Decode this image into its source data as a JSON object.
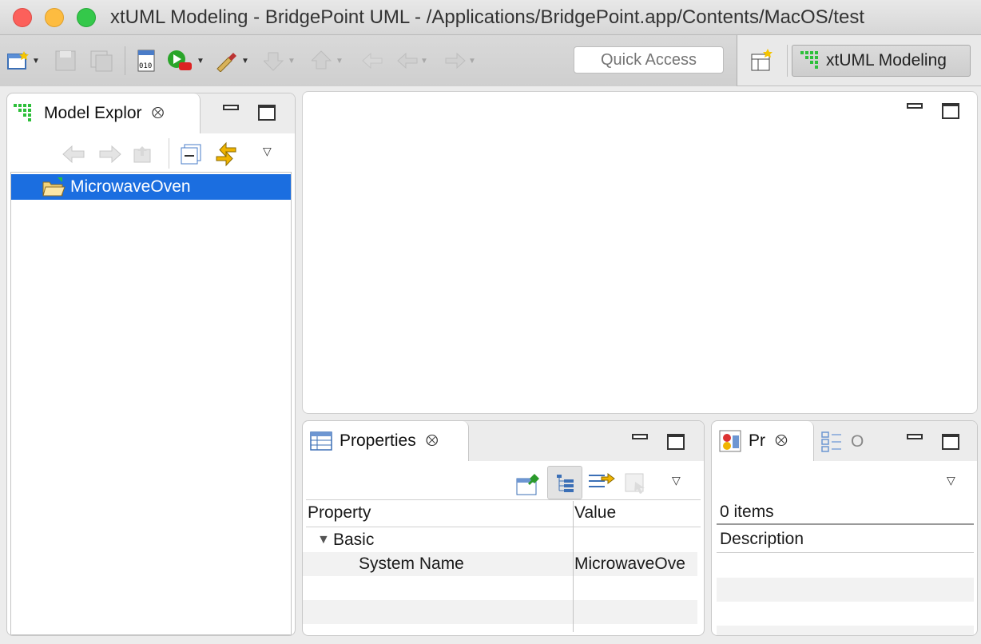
{
  "window": {
    "title": "xtUML Modeling - BridgePoint UML - /Applications/BridgePoint.app/Contents/MacOS/test"
  },
  "toolbar": {
    "quick_access_placeholder": "Quick Access",
    "perspective_label": "xtUML Modeling"
  },
  "model_explorer": {
    "tab_label": "Model Explor",
    "tree_items": [
      {
        "label": "MicrowaveOven",
        "selected": true
      }
    ]
  },
  "properties": {
    "tab_label": "Properties",
    "columns": [
      "Property",
      "Value"
    ],
    "group": "Basic",
    "rows": [
      {
        "property": "System Name",
        "value": "MicrowaveOve"
      }
    ]
  },
  "problems": {
    "tab_label": "Pr",
    "second_tab_label": "O",
    "count_text": "0 items",
    "column": "Description"
  },
  "colors": {
    "selection": "#1b6ee0",
    "xtuml_green": "#2dbf3a"
  }
}
